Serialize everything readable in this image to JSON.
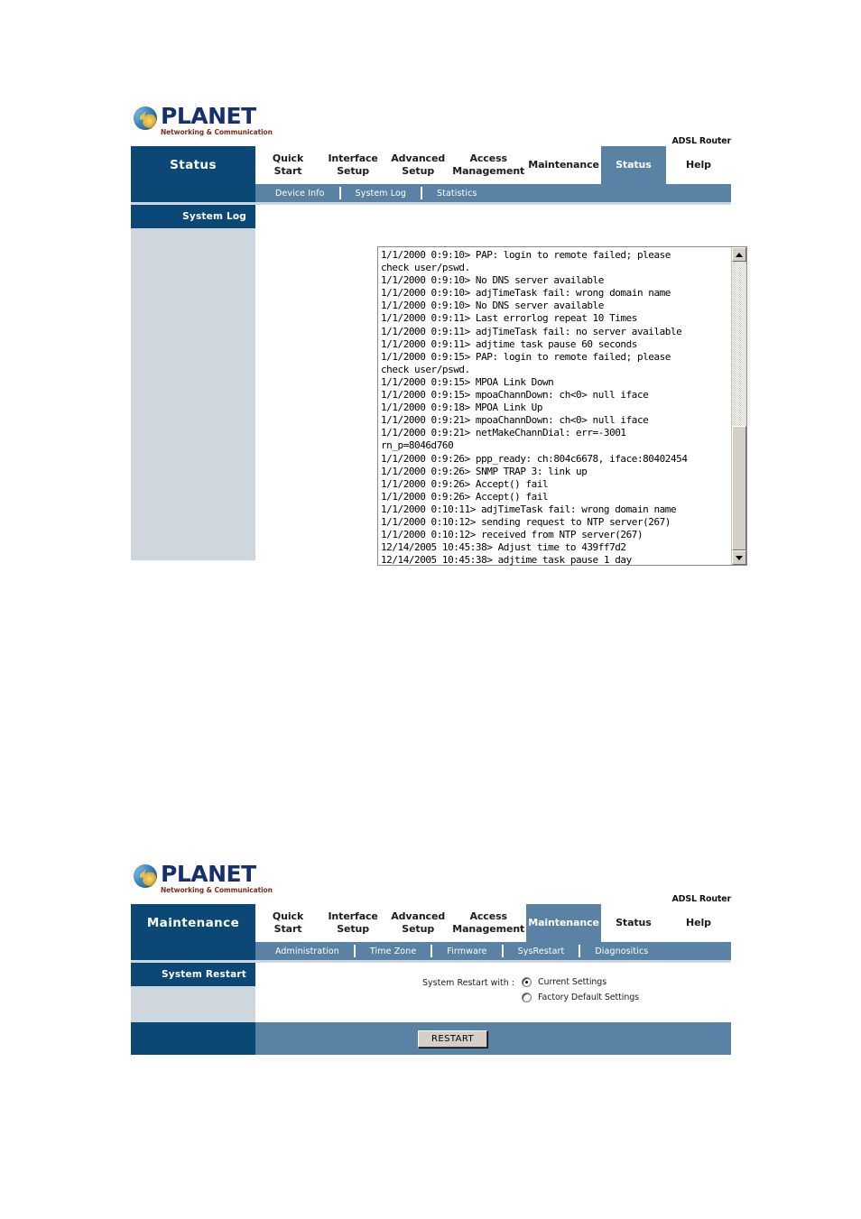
{
  "brand": {
    "logo_name": "PLANET",
    "logo_tagline": "Networking & Communication",
    "logo_icon": "planet-globe-icon",
    "device_label": "ADSL Router"
  },
  "panels": [
    {
      "id": "status",
      "section_title": "Status",
      "main_tabs": [
        {
          "label": "Quick Start",
          "line1": "Quick",
          "line2": "Start",
          "active": false
        },
        {
          "label": "Interface Setup",
          "line1": "Interface",
          "line2": "Setup",
          "active": false
        },
        {
          "label": "Advanced Setup",
          "line1": "Advanced",
          "line2": "Setup",
          "active": false
        },
        {
          "label": "Access Management",
          "line1": "Access",
          "line2": "Management",
          "active": false
        },
        {
          "label": "Maintenance",
          "line1": "Maintenance",
          "line2": "",
          "active": false
        },
        {
          "label": "Status",
          "line1": "Status",
          "line2": "",
          "active": true
        },
        {
          "label": "Help",
          "line1": "Help",
          "line2": "",
          "active": false
        }
      ],
      "sub_tabs": [
        {
          "label": "Device Info"
        },
        {
          "label": "System Log"
        },
        {
          "label": "Statistics"
        }
      ],
      "sidebar_heading": "System Log",
      "log_text": "1/1/2000 0:9:10> PAP: login to remote failed; please\ncheck user/pswd.\n1/1/2000 0:9:10> No DNS server available\n1/1/2000 0:9:10> adjTimeTask fail: wrong domain name\n1/1/2000 0:9:10> No DNS server available\n1/1/2000 0:9:11> Last errorlog repeat 10 Times\n1/1/2000 0:9:11> adjTimeTask fail: no server available\n1/1/2000 0:9:11> adjtime task pause 60 seconds\n1/1/2000 0:9:15> PAP: login to remote failed; please\ncheck user/pswd.\n1/1/2000 0:9:15> MPOA Link Down\n1/1/2000 0:9:15> mpoaChannDown: ch<0> null iface\n1/1/2000 0:9:18> MPOA Link Up\n1/1/2000 0:9:21> mpoaChannDown: ch<0> null iface\n1/1/2000 0:9:21> netMakeChannDial: err=-3001\nrn_p=8046d760\n1/1/2000 0:9:26> ppp_ready: ch:804c6678, iface:80402454\n1/1/2000 0:9:26> SNMP TRAP 3: link up\n1/1/2000 0:9:26> Accept() fail\n1/1/2000 0:9:26> Accept() fail\n1/1/2000 0:10:11> adjTimeTask fail: wrong domain name\n1/1/2000 0:10:12> sending request to NTP server(267)\n1/1/2000 0:10:12> received from NTP server(267)\n12/14/2005 10:45:38> Adjust time to 439ff7d2\n12/14/2005 10:45:38> adjtime task pause 1 day"
    },
    {
      "id": "maintenance",
      "section_title": "Maintenance",
      "main_tabs": [
        {
          "label": "Quick Start",
          "line1": "Quick",
          "line2": "Start",
          "active": false
        },
        {
          "label": "Interface Setup",
          "line1": "Interface",
          "line2": "Setup",
          "active": false
        },
        {
          "label": "Advanced Setup",
          "line1": "Advanced",
          "line2": "Setup",
          "active": false
        },
        {
          "label": "Access Management",
          "line1": "Access",
          "line2": "Management",
          "active": false
        },
        {
          "label": "Maintenance",
          "line1": "Maintenance",
          "line2": "",
          "active": true
        },
        {
          "label": "Status",
          "line1": "Status",
          "line2": "",
          "active": false
        },
        {
          "label": "Help",
          "line1": "Help",
          "line2": "",
          "active": false
        }
      ],
      "sub_tabs": [
        {
          "label": "Administration"
        },
        {
          "label": "Time Zone"
        },
        {
          "label": "Firmware"
        },
        {
          "label": "SysRestart"
        },
        {
          "label": "Diagnositics"
        }
      ],
      "sidebar_heading": "System Restart",
      "form": {
        "field_label": "System Restart with :",
        "options": [
          {
            "label": "Current Settings",
            "selected": true
          },
          {
            "label": "Factory Default Settings",
            "selected": false
          }
        ]
      },
      "footer_button": "RESTART"
    }
  ],
  "colors": {
    "navy": "#0b4875",
    "steel_blue": "#5a82a4",
    "light_blue_gray": "#ced7de",
    "logo_navy": "#16306e",
    "logo_tagline_red": "#7e2d18"
  }
}
